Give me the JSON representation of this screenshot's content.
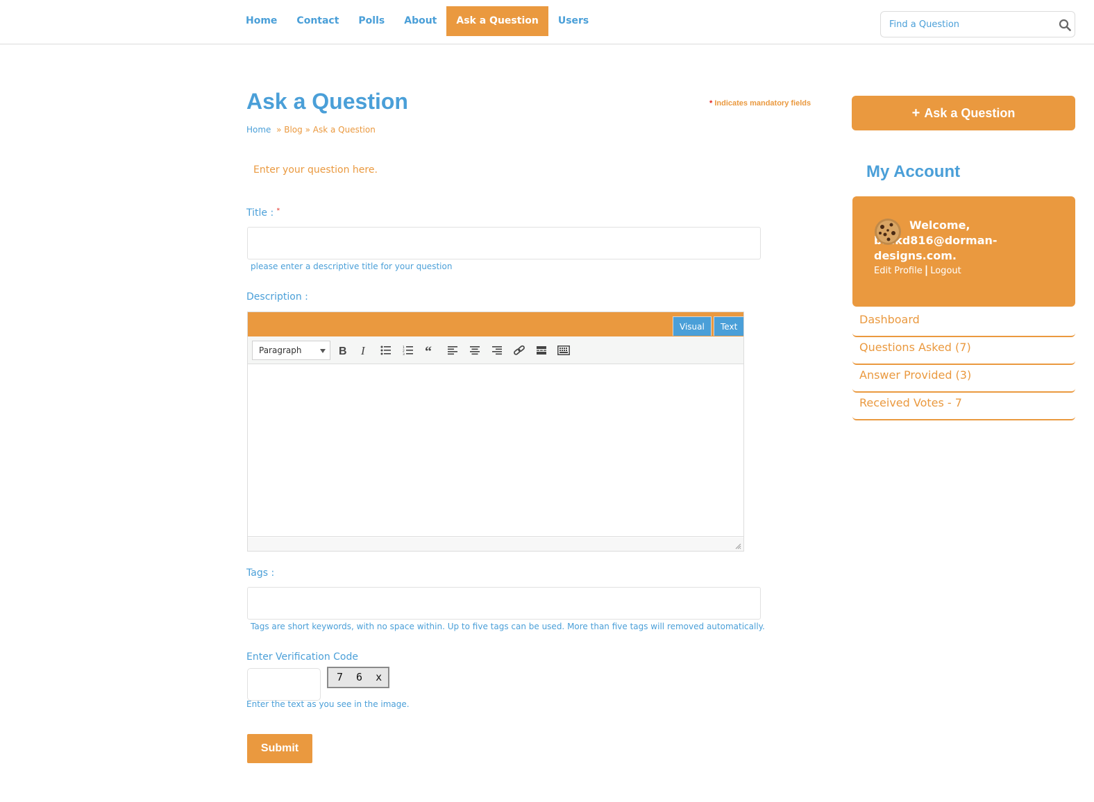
{
  "nav": {
    "items": [
      {
        "label": "Home",
        "active": false
      },
      {
        "label": "Contact",
        "active": false
      },
      {
        "label": "Polls",
        "active": false
      },
      {
        "label": "About",
        "active": false
      },
      {
        "label": "Ask a Question",
        "active": true
      },
      {
        "label": "Users",
        "active": false
      }
    ],
    "search_placeholder": "Find a Question",
    "search_icon": "search-icon"
  },
  "page": {
    "title": "Ask a Question",
    "mandatory_note": "Indicates mandatory fields",
    "mandatory_star": "*",
    "breadcrumb": {
      "home": "Home",
      "blog": "» Blog",
      "current": "» Ask a Question"
    },
    "intro": "Enter your question here."
  },
  "form": {
    "title_label": "Title :",
    "title_req": "*",
    "title_value": "",
    "title_hint": "please enter a descriptive title for your question",
    "description_label": "Description :",
    "editor": {
      "tab_visual": "Visual",
      "tab_text": "Text",
      "format_select": "Paragraph",
      "tools": [
        "bold-icon",
        "italic-icon",
        "bulleted-list-icon",
        "numbered-list-icon",
        "blockquote-icon",
        "align-left-icon",
        "align-center-icon",
        "align-right-icon",
        "link-icon",
        "read-more-icon",
        "toolbar-toggle-icon"
      ],
      "content": ""
    },
    "tags_label": "Tags :",
    "tags_value": "",
    "tags_hint": "Tags are short keywords, with no space within. Up to five tags can be used. More than five tags will removed automatically.",
    "verification_label": "Enter Verification Code",
    "verification_value": "",
    "captcha_text": "7 6 x",
    "verification_hint": "Enter the text as you see in the image.",
    "submit_label": "Submit"
  },
  "sidebar": {
    "ask_button": "Ask a Question",
    "ask_plus": "+",
    "account_title": "My Account",
    "welcome": "Welcome, brekd816@dorman-designs.com.",
    "edit_profile": "Edit Profile",
    "separator": "|",
    "logout": "Logout",
    "menu": [
      {
        "label": "Dashboard"
      },
      {
        "label": "Questions Asked (7)"
      },
      {
        "label": "Answer Provided (3)"
      },
      {
        "label": "Received Votes - 7"
      }
    ]
  },
  "colors": {
    "accent_orange": "#ea993f",
    "link_blue": "#4a9fd8",
    "required_red": "#e2231a"
  }
}
